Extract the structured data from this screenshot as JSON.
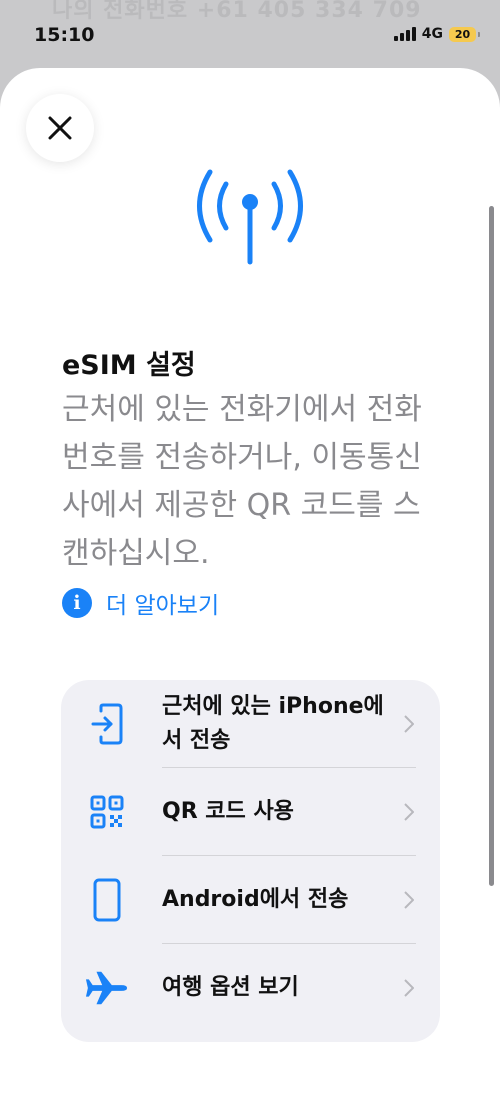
{
  "status": {
    "background_text": "나의 전화번호  +61 405 334 709",
    "time": "15:10",
    "network": "4G",
    "battery": "20"
  },
  "sheet": {
    "title": "eSIM 설정",
    "description": "근처에 있는 전화기에서 전화번호를 전송하거나, 이동통신사에서 제공한 QR 코드를 스캔하십시오.",
    "learn_more": "더 알아보기",
    "options": [
      {
        "label": "근처에 있는 iPhone에서 전송",
        "icon": "phone-transfer-icon"
      },
      {
        "label": "QR 코드 사용",
        "icon": "qr-code-icon"
      },
      {
        "label": "Android에서 전송",
        "icon": "android-phone-icon"
      },
      {
        "label": "여행 옵션 보기",
        "icon": "airplane-icon"
      }
    ]
  },
  "colors": {
    "accent": "#1a82f7",
    "secondary_text": "#8a8a8e",
    "group_bg": "#f0f0f5"
  }
}
